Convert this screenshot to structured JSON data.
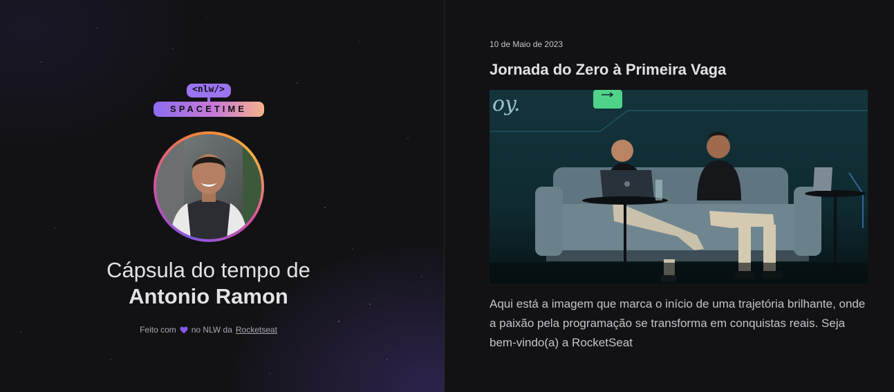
{
  "brand": {
    "logo_tag": "<nlw/>",
    "logo_name": "SPACETIME"
  },
  "profile": {
    "headline_prefix": "Cápsula do tempo de",
    "name": "Antonio Ramon"
  },
  "footer": {
    "made_with": "Feito com",
    "at_text": "no NLW da",
    "link_label": "Rocketseat"
  },
  "memory": {
    "date": "10 de Maio de 2023",
    "title": "Jornada do Zero à Primeira Vaga",
    "description": "Aqui está a imagem que marca o início de uma trajetória brilhante, onde a paixão pela programação se transforma em conquistas reais. Seja bem-vindo(a) a RocketSeat"
  },
  "icons": {
    "heart": "heart-icon",
    "logo": "nlw-spacetime-logo"
  },
  "colors": {
    "accent_purple": "#8257e5",
    "background": "#121215",
    "text_primary": "#e1e1e6",
    "text_secondary": "#c4c4cc"
  }
}
